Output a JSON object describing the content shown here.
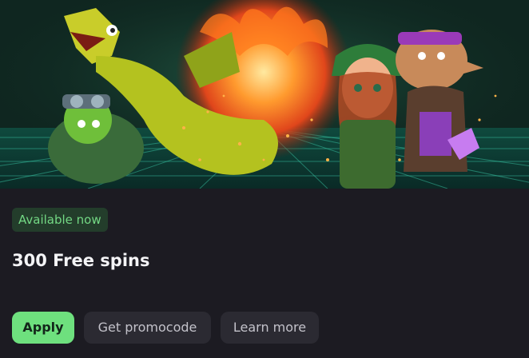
{
  "promo": {
    "badge": "Available now",
    "title": "300 Free spins"
  },
  "actions": {
    "apply_label": "Apply",
    "promocode_label": "Get promocode",
    "learn_more_label": "Learn more"
  },
  "banner": {
    "characters": [
      "dragon",
      "turtle",
      "elf-girl",
      "goblin"
    ],
    "effects": [
      "fire-orb",
      "sparks",
      "neon-grid-floor"
    ]
  },
  "colors": {
    "background": "#1c1b22",
    "accent_green": "#6ee07e",
    "badge_bg": "#233d2b",
    "badge_text": "#73d884",
    "secondary_button": "#2b2a32"
  }
}
